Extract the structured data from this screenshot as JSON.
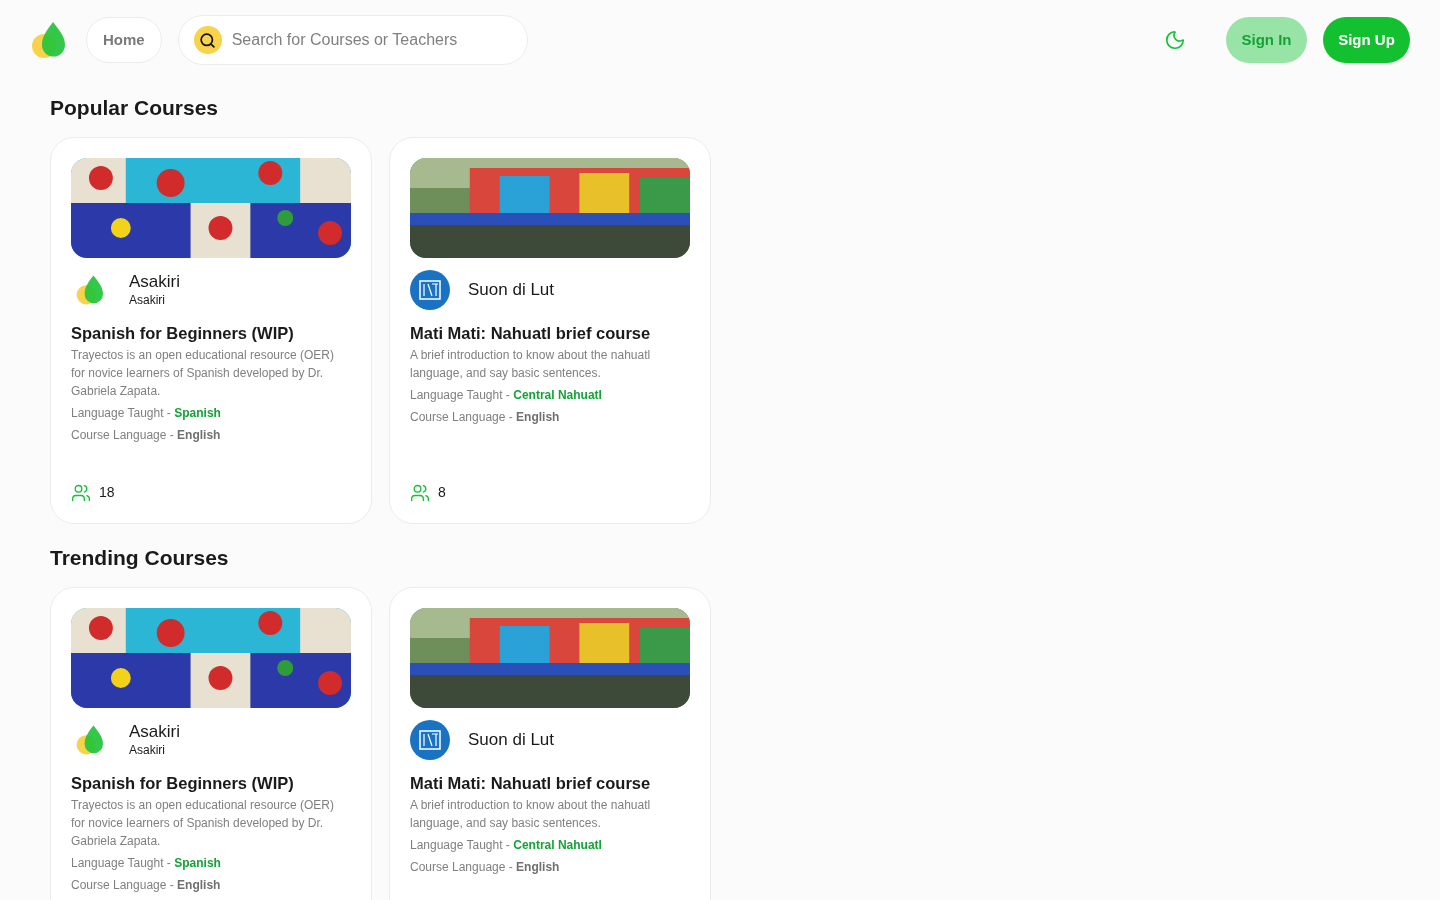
{
  "nav": {
    "home": "Home",
    "search": {
      "placeholder": "Search for Courses or Teachers"
    },
    "sign_in": "Sign In",
    "sign_up": "Sign Up"
  },
  "sections": [
    {
      "title": "Popular Courses",
      "courses": [
        {
          "author": {
            "name": "Asakiri",
            "handle": "Asakiri"
          },
          "title": "Spanish for Beginners (WIP)",
          "description": "Trayectos is an open educational resource (OER) for novice learners of Spanish developed by Dr. Gabriela Zapata.",
          "taught_label": "Language Taught -",
          "taught": "Spanish",
          "course_label": "Course Language -",
          "course_language": "English",
          "learners": "18"
        },
        {
          "author": {
            "name": "Suon di Lut"
          },
          "title": "Mati Mati: Nahuatl brief course",
          "description": "A brief introduction to know about the nahuatl language, and say basic sentences.",
          "taught_label": "Language Taught -",
          "taught": "Central Nahuatl",
          "course_label": "Course Language -",
          "course_language": "English",
          "learners": "8"
        }
      ]
    },
    {
      "title": "Trending Courses",
      "courses": [
        {
          "author": {
            "name": "Asakiri",
            "handle": "Asakiri"
          },
          "title": "Spanish for Beginners (WIP)",
          "description": "Trayectos is an open educational resource (OER) for novice learners of Spanish developed by Dr. Gabriela Zapata.",
          "taught_label": "Language Taught -",
          "taught": "Spanish",
          "course_label": "Course Language -",
          "course_language": "English"
        },
        {
          "author": {
            "name": "Suon di Lut"
          },
          "title": "Mati Mati: Nahuatl brief course",
          "description": "A brief introduction to know about the nahuatl language, and say basic sentences.",
          "taught_label": "Language Taught -",
          "taught": "Central Nahuatl",
          "course_label": "Course Language -",
          "course_language": "English"
        }
      ]
    }
  ]
}
